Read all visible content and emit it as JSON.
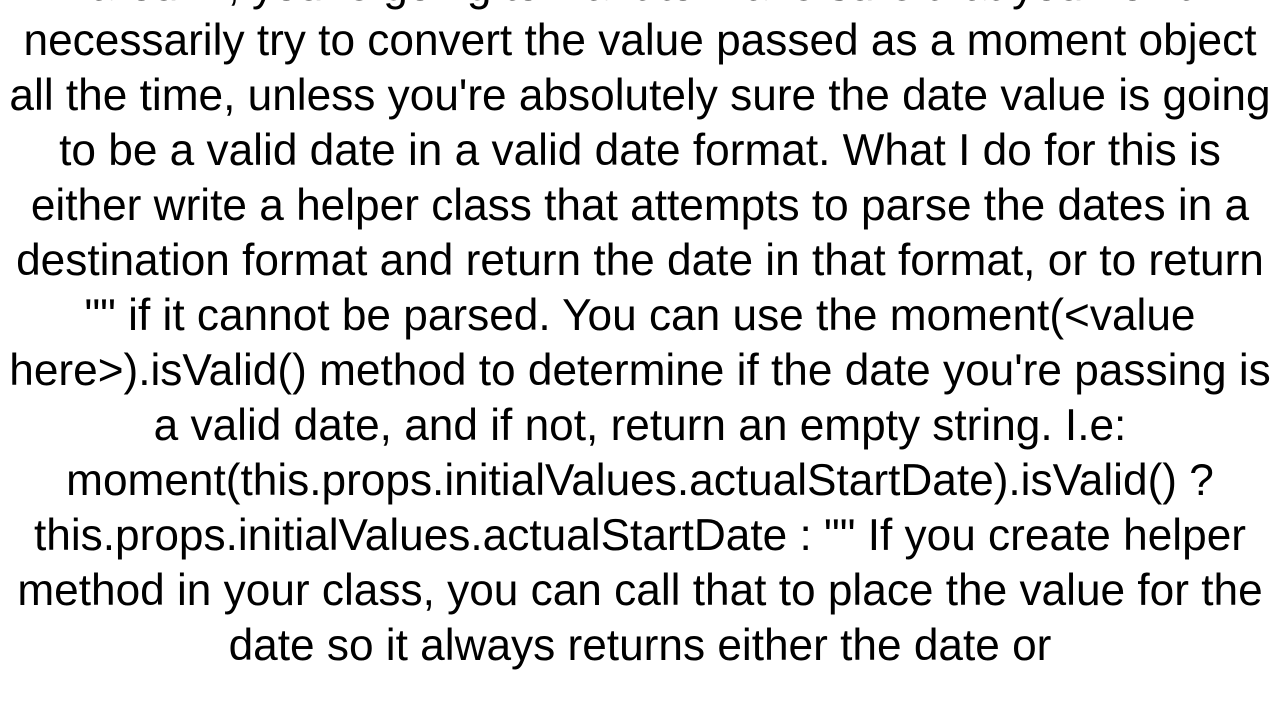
{
  "body": {
    "paragraph": "around, you're going to want to make sure that you don't necessarily try to convert the value passed as a moment object all the time, unless you're absolutely sure the date value is going to be a valid date in a valid date format. What I do for this is either write a helper class that attempts to parse the dates in a destination format and return the date in that format, or to return \"\" if it cannot be parsed. You can use the moment(<value here>).isValid() method to determine if the date you're passing is a valid date, and if not, return an empty string. I.e: moment(this.props.initialValues.actualStartDate).isValid() ? this.props.initialValues.actualStartDate : \"\" If you create helper method in your class, you can call that to place the value for the date so it always returns either the date or"
  }
}
